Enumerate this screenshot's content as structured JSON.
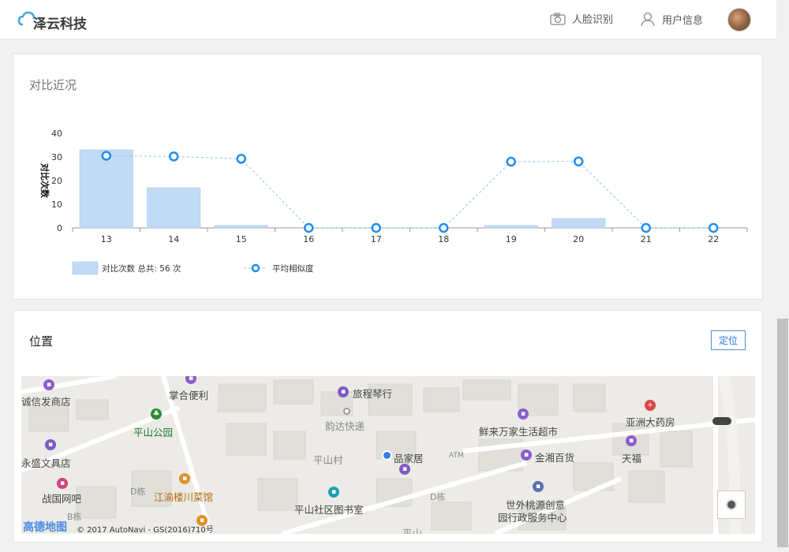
{
  "header": {
    "brand": "泽云科技",
    "nav_face": "人脸识别",
    "nav_user": "用户信息"
  },
  "compare": {
    "title": "对比近况"
  },
  "chart_data": {
    "type": "bar",
    "categories": [
      "13",
      "14",
      "15",
      "16",
      "17",
      "18",
      "19",
      "20",
      "21",
      "22"
    ],
    "series": [
      {
        "name": "对比次数 总共: 56 次",
        "type": "bar",
        "values": [
          33,
          17,
          1,
          0,
          0,
          0,
          1,
          4,
          0,
          0
        ]
      },
      {
        "name": "平均相似度",
        "type": "line",
        "values": [
          30.5,
          30.2,
          29.2,
          0,
          0,
          0,
          28,
          28.1,
          0,
          0
        ]
      }
    ],
    "ylabel": "对比次数",
    "ylim": [
      0,
      40
    ],
    "yticks": [
      0,
      10,
      20,
      30,
      40
    ],
    "grid": false,
    "legend": "bottom-left",
    "colors": {
      "bar": "#c2dbf5",
      "bar_edge": "#9fc3ec",
      "line": "#1e8ef0"
    }
  },
  "location": {
    "title": "位置",
    "locate_button": "定位"
  },
  "map": {
    "labels": [
      {
        "text": "诚信发商店",
        "style": ""
      },
      {
        "text": "掌合便利",
        "style": ""
      },
      {
        "text": "旅程琴行",
        "style": ""
      },
      {
        "text": "平山公园",
        "style": "green"
      },
      {
        "text": "韵达快递",
        "style": "grey"
      },
      {
        "text": "鲜来万家生活超市",
        "style": ""
      },
      {
        "text": "亚洲大药房",
        "style": ""
      },
      {
        "text": "永盛文具店",
        "style": ""
      },
      {
        "text": "平山村",
        "style": "grey"
      },
      {
        "text": "品家居",
        "style": ""
      },
      {
        "text": "ATM",
        "style": "grey"
      },
      {
        "text": "金湘百货",
        "style": ""
      },
      {
        "text": "天福",
        "style": ""
      },
      {
        "text": "战国网吧",
        "style": ""
      },
      {
        "text": "D栋",
        "style": "grey"
      },
      {
        "text": "江渝楼川菜馆",
        "style": "orange"
      },
      {
        "text": "平山社区图书室",
        "style": ""
      },
      {
        "text": "D栋",
        "style": "grey"
      },
      {
        "text": "世外桃源创意",
        "style": ""
      },
      {
        "text": "园行政服务中心",
        "style": ""
      },
      {
        "text": "B栋",
        "style": "grey"
      },
      {
        "text": "平山",
        "style": "grey"
      }
    ],
    "logo": "高德地图",
    "copyright": "© 2017 AutoNavi - GS(2016)710号"
  }
}
